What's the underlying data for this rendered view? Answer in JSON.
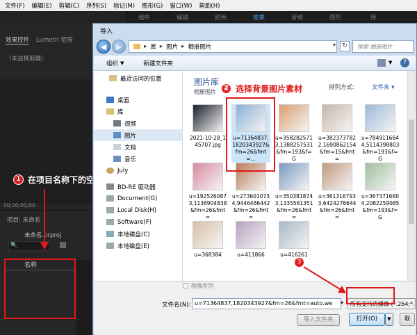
{
  "menubar": [
    "文件(F)",
    "编辑(E)",
    "剪辑(C)",
    "序列(S)",
    "标记(M)",
    "图形(G)",
    "窗口(W)",
    "帮助(H)"
  ],
  "workspace_tabs": [
    "组件",
    "编辑",
    "颜色",
    "效果",
    "音频",
    "图形",
    "库"
  ],
  "left_panel": {
    "tab1": "效果控件",
    "tab2": "Lumetri 范围",
    "no_clip": "（未选择剪辑）",
    "timecode": "00;00;00;00",
    "project_tab": "项目: 未命名",
    "project_file": "未命名.prproj",
    "name_header": "名称"
  },
  "dialog": {
    "title": "导入",
    "breadcrumb": [
      "库",
      "图片",
      "相册图片"
    ],
    "search_placeholder": "搜索 相册图片",
    "toolbar": {
      "organize": "组织",
      "new_folder": "新建文件夹"
    },
    "nav_items": [
      "最近访问的位置",
      "桌面",
      "库",
      "视频",
      "图片",
      "文档",
      "音乐",
      "July",
      "BD-RE 驱动器",
      "Document(G)",
      "Local Disk(H)",
      "Software(F)",
      "本地磁盘(C)",
      "本地磁盘(E)"
    ],
    "library_title": "图片库",
    "library_sub": "相册图片",
    "arrange_label": "排列方式:",
    "arrange_value": "文件夹",
    "thumbs": [
      {
        "cap": "2021-10-28_145707.jpg",
        "color": "#1a1f2a"
      },
      {
        "cap": "u=71364837,1820343927&fm=26&fmt=...",
        "color": "#8db0d6"
      },
      {
        "cap": "u=3582825713,1388257531&fm=193&f=G",
        "color": "#d9a070"
      },
      {
        "cap": "u=3823737822,1690862154&fm=15&fmt=",
        "color": "#c8b6a8"
      },
      {
        "cap": "u=7849116644,5114398803&fm=193&f=G",
        "color": "#9eb8d8"
      },
      {
        "cap": "u=1925260873,1136904838&fm=26&fmt=",
        "color": "#d88aa0"
      },
      {
        "cap": "u=2736010734,9446486442&fm=26&fmt=",
        "color": "#b87a5a"
      },
      {
        "cap": "u=3503818743,1335561351&fm=26&fmt=",
        "color": "#7a9ac0"
      },
      {
        "cap": "u=3613167933,6424276644&fm=26&fmt=",
        "color": "#c09a80"
      },
      {
        "cap": "u=3673716604,2082259085&fm=193&f=G",
        "color": "#a0c0a0"
      },
      {
        "cap": "u=368384",
        "color": "#d8c0a8"
      },
      {
        "cap": "u=411866",
        "color": "#b8a0c0"
      },
      {
        "cap": "u=416261",
        "color": "#a8b8c8"
      }
    ],
    "seq_checkbox": "图像序列",
    "filename_label": "文件名(N):",
    "filename_value": "u=71364837,1820343927&fm=26&fmt=auto.we",
    "filetype": "所有支持的媒体 (*.264;*.",
    "import_folder_btn": "导入文件夹",
    "open_btn": "打开(O)",
    "cancel_btn": "取"
  },
  "annotations": {
    "a1": "在项目名称下的空白处，双击它",
    "a2": "选择背景图片素材",
    "n1": "1",
    "n2": "2",
    "n3": "3"
  },
  "colors": {
    "red": "#e01818",
    "accent": "#4aa0e8"
  }
}
